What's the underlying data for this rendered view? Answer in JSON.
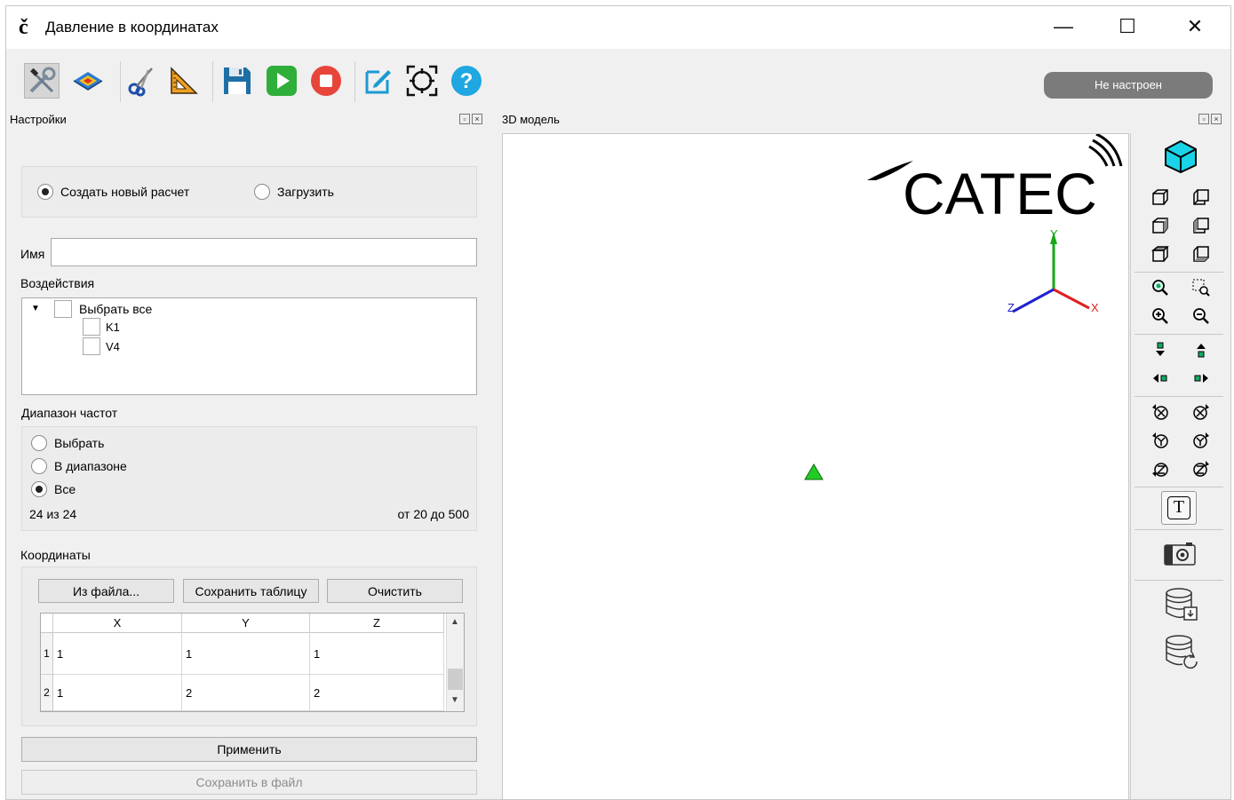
{
  "window": {
    "title": "Давление в координатах",
    "minimize": "—",
    "maximize": "☐",
    "close": "✕",
    "logo": "č"
  },
  "toolbar": {
    "status": "Не настроен"
  },
  "settings": {
    "dock_title": "Настройки",
    "mode_new": "Создать новый расчет",
    "mode_load": "Загрузить",
    "name_label": "Имя",
    "name_value": "",
    "actions_label": "Воздействия",
    "select_all": "Выбрать все",
    "actions": [
      "K1",
      "V4"
    ],
    "freq_label": "Диапазон частот",
    "freq_options": [
      "Выбрать",
      "В диапазоне",
      "Все"
    ],
    "freq_selected": "Все",
    "freq_count": "24 из 24",
    "freq_range": "от 20 до 500",
    "coords_label": "Координаты",
    "btn_from_file": "Из файла...",
    "btn_save_table": "Сохранить таблицу",
    "btn_clear": "Очистить",
    "table": {
      "columns": [
        "X",
        "Y",
        "Z"
      ],
      "rows": [
        {
          "index": "1",
          "x": "1",
          "y": "1",
          "z": "1"
        },
        {
          "index": "2",
          "x": "1",
          "y": "2",
          "z": "2"
        }
      ]
    },
    "btn_apply": "Применить",
    "btn_save_file": "Сохранить в файл"
  },
  "model": {
    "dock_title": "3D модель",
    "logo_text": "CATEC",
    "axis_x": "X",
    "axis_y": "Y",
    "axis_z": "Z",
    "colors": {
      "axis_x": "#e02020",
      "axis_y": "#18a818",
      "axis_z": "#2020d0",
      "marker": "#22cc22"
    }
  },
  "side_tools": {
    "text_tool": "T"
  }
}
